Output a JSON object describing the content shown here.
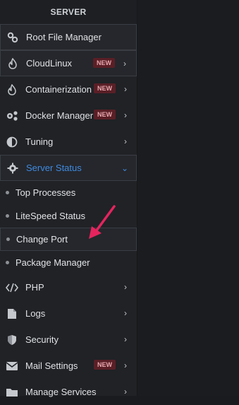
{
  "sidebar": {
    "section_title": "SERVER",
    "items": [
      {
        "label": "Root File Manager",
        "icon": "link-icon"
      },
      {
        "label": "CloudLinux",
        "icon": "flame-icon",
        "badge": "NEW"
      },
      {
        "label": "Containerization",
        "icon": "flame-icon",
        "badge": "NEW"
      },
      {
        "label": "Docker Manager",
        "icon": "gears-icon",
        "badge": "NEW"
      },
      {
        "label": "Tuning",
        "icon": "contrast-icon"
      },
      {
        "label": "Server Status",
        "icon": "gear-icon"
      }
    ],
    "submenu": [
      {
        "label": "Top Processes"
      },
      {
        "label": "LiteSpeed Status"
      },
      {
        "label": "Change Port"
      },
      {
        "label": "Package Manager"
      }
    ],
    "items2": [
      {
        "label": "PHP",
        "icon": "code-icon"
      },
      {
        "label": "Logs",
        "icon": "file-icon"
      },
      {
        "label": "Security",
        "icon": "shield-icon"
      },
      {
        "label": "Mail Settings",
        "icon": "envelope-icon",
        "badge": "NEW"
      },
      {
        "label": "Manage Services",
        "icon": "folder-icon"
      }
    ]
  },
  "colors": {
    "active": "#3f8ae0",
    "badge_bg": "#5a1f26",
    "arrow": "#e5245e"
  }
}
